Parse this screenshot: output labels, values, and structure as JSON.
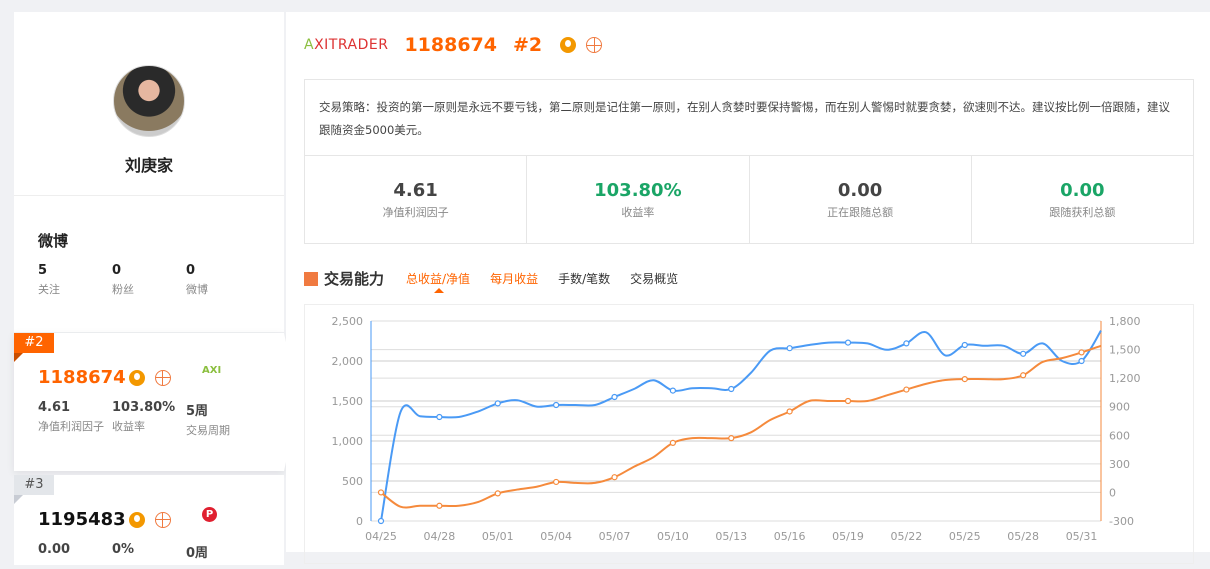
{
  "profile": {
    "name": "刘庚家"
  },
  "weibo": {
    "title": "微博",
    "stats": [
      {
        "value": "5",
        "label": "关注"
      },
      {
        "value": "0",
        "label": "粉丝"
      },
      {
        "value": "0",
        "label": "微博"
      }
    ]
  },
  "ranking": [
    {
      "rank": "#2",
      "id": "1188674",
      "broker": "AXI",
      "stats": [
        {
          "value": "4.61",
          "label": "净值利润因子"
        },
        {
          "value": "103.80%",
          "label": "收益率"
        },
        {
          "value": "5周",
          "label": "交易周期"
        }
      ]
    },
    {
      "rank": "#3",
      "id": "1195483",
      "broker": "P",
      "stats": [
        {
          "value": "0.00",
          "label": ""
        },
        {
          "value": "0%",
          "label": ""
        },
        {
          "value": "0周",
          "label": ""
        }
      ]
    }
  ],
  "header": {
    "broker_logo": "AXITRADER",
    "account": "1188674",
    "rank": "#2"
  },
  "strategy": "交易策略：投资的第一原则是永远不要亏钱，第二原则是记住第一原则，在别人贪婪时要保持警惕，而在别人警惕时就要贪婪，欲速则不达。建议按比例一倍跟随，建议跟随资金5000美元。",
  "kpis": [
    {
      "value": "4.61",
      "label": "净值利润因子"
    },
    {
      "value": "103.80%",
      "label": "收益率"
    },
    {
      "value": "0.00",
      "label": "正在跟随总额"
    },
    {
      "value": "0.00",
      "label": "跟随获利总额"
    }
  ],
  "section": {
    "title": "交易能力",
    "tabs": [
      "总收益/净值",
      "每月收益",
      "手数/笔数",
      "交易概览"
    ]
  },
  "colors": {
    "accent": "#ff6400",
    "green": "#1aa566",
    "blue": "#4a9af5",
    "orange": "#f58a3c"
  },
  "chart_data": {
    "type": "line",
    "x_ticks": [
      "04/25",
      "04/28",
      "05/01",
      "05/04",
      "05/07",
      "05/10",
      "05/13",
      "05/16",
      "05/19",
      "05/22",
      "05/25",
      "05/28",
      "05/31"
    ],
    "y_left": {
      "range": [
        0,
        2500
      ],
      "ticks": [
        "0",
        "500",
        "1,000",
        "1,500",
        "2,000",
        "2,500"
      ]
    },
    "y_right": {
      "range": [
        -300,
        1800
      ],
      "ticks": [
        "-300",
        "0",
        "300",
        "600",
        "900",
        "1,200",
        "1,500",
        "1,800"
      ]
    },
    "series": [
      {
        "name": "净值",
        "axis": "left",
        "color": "#4a9af5",
        "values": [
          0,
          1360,
          1310,
          1300,
          1300,
          1370,
          1470,
          1510,
          1430,
          1450,
          1450,
          1450,
          1550,
          1650,
          1760,
          1630,
          1660,
          1660,
          1650,
          1850,
          2130,
          2160,
          2200,
          2230,
          2230,
          2220,
          2140,
          2220,
          2360,
          2070,
          2200,
          2190,
          2190,
          2090,
          2220,
          2000,
          2000,
          2380
        ]
      },
      {
        "name": "总收益",
        "axis": "right",
        "color": "#f58a3c",
        "values": [
          0,
          -150,
          -140,
          -140,
          -140,
          -100,
          -10,
          30,
          60,
          110,
          100,
          100,
          160,
          270,
          370,
          520,
          570,
          570,
          570,
          630,
          760,
          850,
          960,
          960,
          960,
          960,
          1020,
          1080,
          1140,
          1180,
          1190,
          1190,
          1190,
          1230,
          1370,
          1410,
          1470,
          1540
        ]
      }
    ]
  }
}
